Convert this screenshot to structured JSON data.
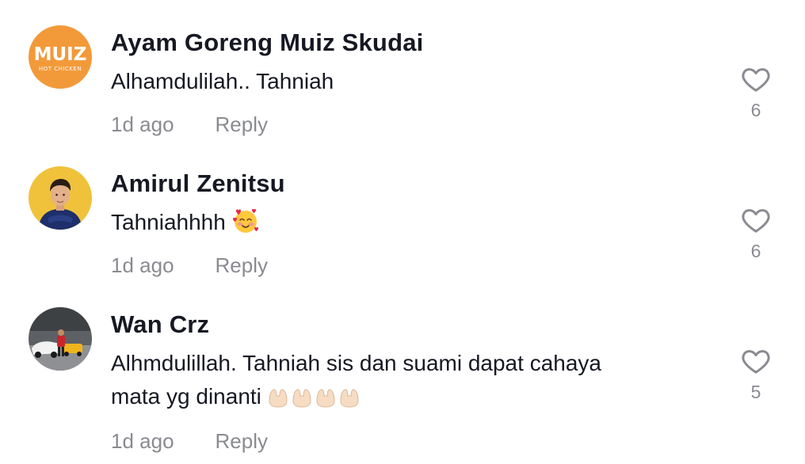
{
  "comments": [
    {
      "username": "Ayam Goreng Muiz Skudai",
      "avatar_text": "MUIZ",
      "avatar_subtext": "HOT CHICKEN",
      "text": "Alhamdulilah.. Tahniah",
      "time": "1d ago",
      "reply_label": "Reply",
      "likes": "6"
    },
    {
      "username": "Amirul Zenitsu",
      "text": "Tahniahhhh",
      "emoji": "smiling-face-with-hearts",
      "time": "1d ago",
      "reply_label": "Reply",
      "likes": "6"
    },
    {
      "username": "Wan Crz",
      "text_line1": "Alhmdulillah. Tahniah sis dan suami dapat cahaya",
      "text_line2": "mata yg dinanti",
      "emoji": "palms-up-together x4",
      "time": "1d ago",
      "reply_label": "Reply",
      "likes": "5"
    }
  ],
  "colors": {
    "username": "#161823",
    "meta": "#8a8b91",
    "muiz_orange": "#f29a3a",
    "avatar2_bg": "#f0c23b"
  }
}
